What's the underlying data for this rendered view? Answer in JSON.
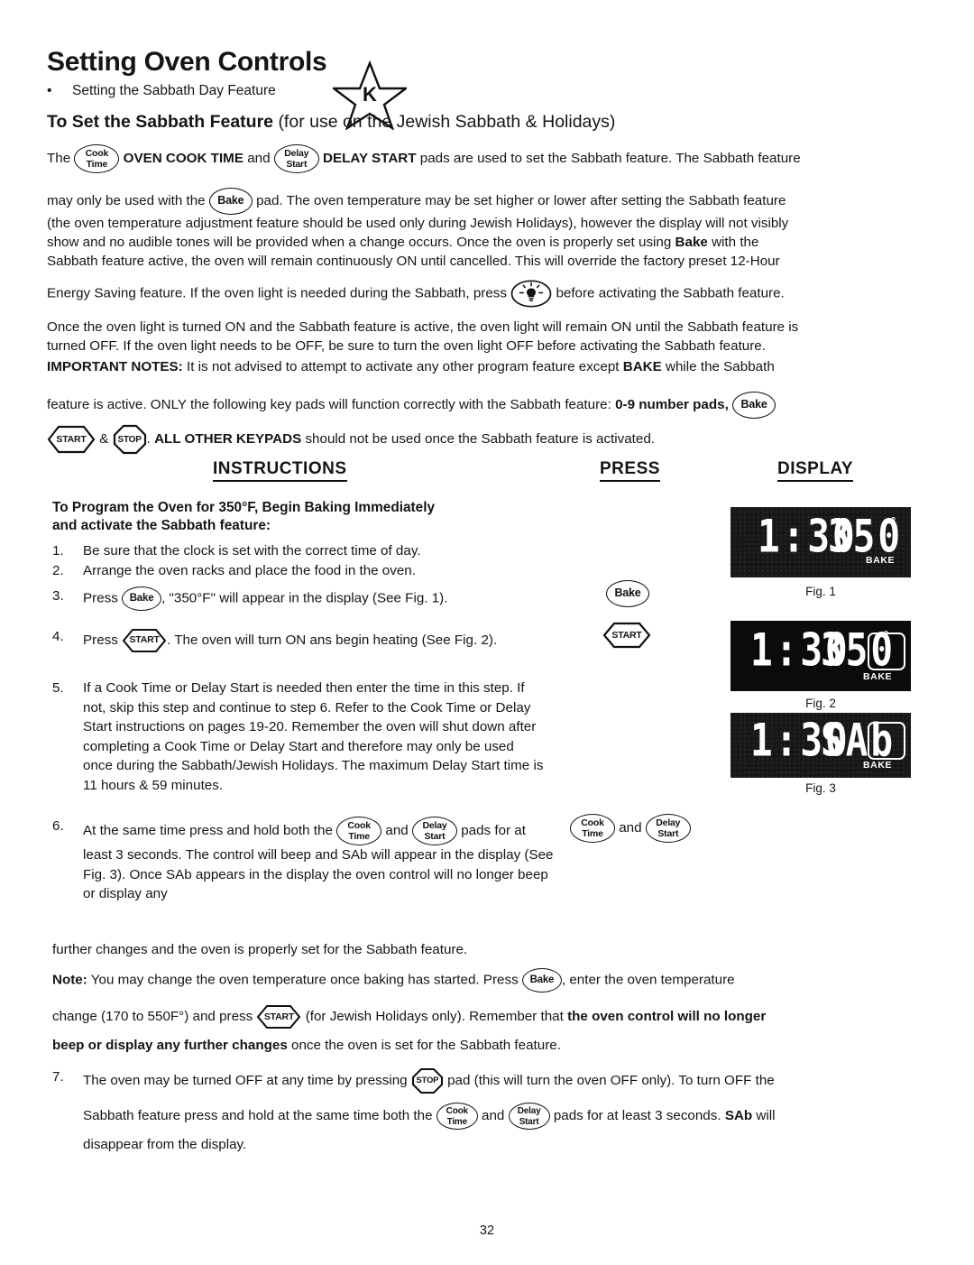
{
  "header": {
    "title": "Setting Oven Controls",
    "bullet": "Setting the Sabbath Day Feature",
    "logo_letter": "K",
    "logo_name": "star-k-kosher-logo",
    "subtitle_bold": "To Set the Sabbath Feature",
    "subtitle_rest": "(for use on the Jewish Sabbath & Holidays)"
  },
  "pads": {
    "cook_time_l1": "Cook",
    "cook_time_l2": "Time",
    "delay_start_l1": "Delay",
    "delay_start_l2": "Start",
    "bake": "Bake",
    "start": "START",
    "stop": "STOP"
  },
  "intro": {
    "l1_a": "The",
    "l1_b": "OVEN COOK TIME",
    "l1_c": "and",
    "l1_d": "DELAY START",
    "l1_e": "pads are used to set the Sabbath feature. The Sabbath feature",
    "l2_a": "may only be used with the",
    "l2_b": "pad. The oven temperature may be set higher or lower after setting the Sabbath feature",
    "l3": "(the oven temperature adjustment feature should be used only during Jewish Holidays), however the display will not visibly",
    "l4_a": "show and no audible tones will be provided when a change occurs. Once the oven is properly set using",
    "l4_b": "Bake",
    "l4_c": "with the",
    "l5": "Sabbath feature active, the oven will remain continuously ON until cancelled. This will override the factory preset 12-Hour",
    "l6_a": "Energy Saving feature. If the oven light is needed during the Sabbath, press",
    "l6_b": "before activating the Sabbath feature.",
    "l7": "Once the oven light is turned ON and the Sabbath feature is active, the oven light will remain ON until the Sabbath feature is",
    "l8": "turned OFF. If the oven light needs to be OFF, be sure to turn the oven light OFF before activating the Sabbath feature.",
    "l9_a": "IMPORTANT NOTES:",
    "l9_b": "It is not advised to attempt to activate any other program feature except",
    "l9_c": "BAKE",
    "l9_d": "while the Sabbath",
    "l10_a": "feature is active. ONLY the following key pads will function correctly with the Sabbath feature:",
    "l10_b": "0-9 number pads,",
    "l11_a": "&",
    "l11_b": ".",
    "l11_c": "ALL OTHER KEYPADS",
    "l11_d": "should not be used once the Sabbath feature is activated."
  },
  "columns": {
    "instructions": "INSTRUCTIONS",
    "press": "PRESS",
    "display": "DISPLAY"
  },
  "instructions": {
    "heading_l1": "To Program the Oven for 350°F, Begin Baking Immediately",
    "heading_l2": "and activate the Sabbath feature:",
    "steps": [
      {
        "num": "1.",
        "text": "Be sure that the clock is set with the correct time of day."
      },
      {
        "num": "2.",
        "text": "Arrange the oven racks and place the food in the oven."
      },
      {
        "num": "3.",
        "a": "Press",
        "b": ", \"350°F\" will appear in the display (See Fig. 1)."
      },
      {
        "num": "4.",
        "a": "Press",
        "b": ". The oven will turn ON ans begin heating (See Fig. 2)."
      },
      {
        "num": "5.",
        "text": "If a Cook Time or Delay Start  is needed then enter the time in this step. If not, skip this step and continue to step 6. Refer to the Cook Time or Delay Start instructions on pages 19-20. Remember the oven will shut down after completing a Cook Time or Delay Start and therefore may only be used once during the Sabbath/Jewish Holidays. The maximum Delay Start time is 11 hours & 59 minutes."
      },
      {
        "num": "6.",
        "a": "At the same time press and hold both the",
        "b": "and",
        "c": "pads for at least 3 seconds. The control will beep and SAb will appear in the display (See Fig. 3). Once SAb appears in the display the oven control will no longer beep or display any"
      }
    ]
  },
  "closing": {
    "l1": "further changes and the oven is properly set for the Sabbath feature.",
    "l2_a": "Note:",
    "l2_b": "You may change the oven temperature once baking has started. Press",
    "l2_c": ", enter the oven temperature",
    "l3_a": "change (170 to 550F°) and press",
    "l3_b": "(for Jewish Holidays only). Remember that",
    "l3_c": "the oven control will no longer",
    "l4_a": "beep or display any further changes",
    "l4_b": "once the oven is set for the Sabbath feature.",
    "step7_num": "7.",
    "step7_a": "The oven may be turned OFF at any time by pressing",
    "step7_b": "pad (this will turn the oven OFF only). To turn OFF the",
    "step7_c": "Sabbath feature press and hold at the same time both the",
    "step7_d": "and",
    "step7_e": "pads for at least 3 seconds.",
    "step7_f": "SAb",
    "step7_g": "will",
    "step7_h": "disappear from the display."
  },
  "displays": {
    "fig1": {
      "time": "1:30",
      "temp": "350",
      "degree": "°",
      "mode": "BAKE",
      "caption": "Fig. 1",
      "has_box": false
    },
    "fig2": {
      "time": "1:30",
      "temp": "350",
      "degree": "°",
      "mode": "BAKE",
      "caption": "Fig. 2",
      "has_box": true
    },
    "fig3": {
      "time": "1:30",
      "temp": "SAb",
      "degree": "",
      "mode": "BAKE",
      "caption": "Fig. 3",
      "has_box": true
    }
  },
  "footer": {
    "page_number": "32"
  }
}
